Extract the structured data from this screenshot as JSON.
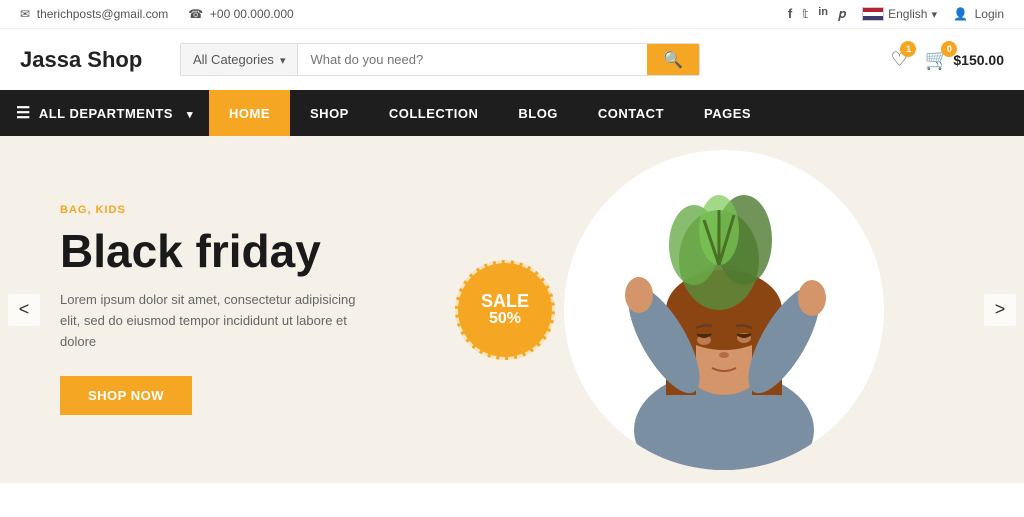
{
  "topbar": {
    "email_icon": "mail-icon",
    "email": "therichposts@gmail.com",
    "phone_icon": "phone-icon",
    "phone": "+00 00.000.000",
    "social": [
      {
        "name": "facebook",
        "label": "f"
      },
      {
        "name": "twitter",
        "label": "t"
      },
      {
        "name": "linkedin",
        "label": "in"
      },
      {
        "name": "pinterest",
        "label": "p"
      }
    ],
    "language": "English",
    "login_icon": "user-icon",
    "login": "Login"
  },
  "header": {
    "logo": "Jassa Shop",
    "search": {
      "category_label": "All Categories",
      "placeholder": "What do you need?",
      "button_label": "search"
    },
    "wishlist_count": "1",
    "cart_count": "0",
    "cart_price": "$150.00"
  },
  "navbar": {
    "departments_label": "ALL DEPARTMENTS",
    "items": [
      {
        "id": "home",
        "label": "HOME",
        "active": true
      },
      {
        "id": "shop",
        "label": "SHOP",
        "active": false
      },
      {
        "id": "collection",
        "label": "COLLECTION",
        "active": false
      },
      {
        "id": "blog",
        "label": "BLOG",
        "active": false
      },
      {
        "id": "contact",
        "label": "CONTACT",
        "active": false
      },
      {
        "id": "pages",
        "label": "PAGES",
        "active": false
      }
    ]
  },
  "hero": {
    "tag": "BAG, KIDS",
    "title": "Black friday",
    "description": "Lorem ipsum dolor sit amet, consectetur adipisicing elit, sed do eiusmod tempor incididunt ut labore et dolore",
    "button_label": "SHOP NOW",
    "sale_text": "SALE",
    "sale_percent": "50%",
    "prev_label": "<",
    "next_label": ">"
  }
}
